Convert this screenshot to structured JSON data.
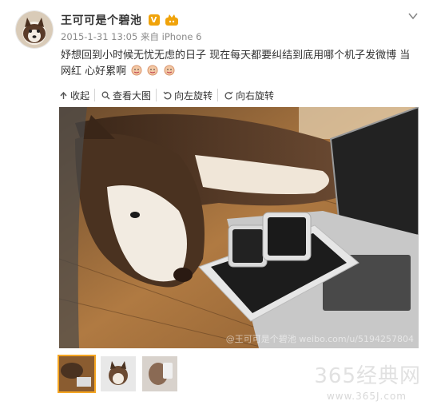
{
  "user": {
    "name": "王可可是个碧池",
    "verified_badge": "V",
    "date": "2015-1-31 13:05",
    "source_prefix": "来自",
    "source": "iPhone 6"
  },
  "post": {
    "text": "妤想回到小时候无忧无虑的日子 现在每天都要纠结到底用哪个机子发微博 当网红 心好累啊"
  },
  "toolbar": {
    "collapse": "收起",
    "view_large": "查看大图",
    "rotate_left": "向左旋转",
    "rotate_right": "向右旋转"
  },
  "photo": {
    "watermark": "@王可可是个碧池 weibo.com/u/5194257804"
  },
  "site": {
    "watermark": "365经典网",
    "url": "www.365J.com"
  },
  "colors": {
    "accent": "#f5a623",
    "badge": "#f0a30a",
    "meta": "#8a8a8a"
  },
  "icons": [
    "collapse-arrow-icon",
    "magnifier-icon",
    "rotate-left-icon",
    "rotate-right-icon",
    "chevron-down-icon"
  ]
}
